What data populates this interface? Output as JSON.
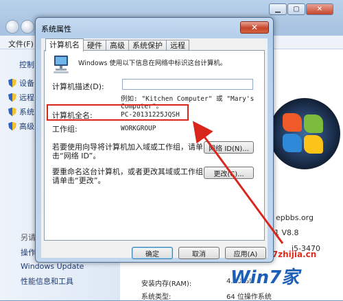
{
  "background": {
    "menu_file": "文件(F)",
    "left_panel": {
      "control": "控制",
      "items": [
        "设备",
        "远程",
        "系统",
        "高级"
      ],
      "see_also": "另请",
      "footer_items": [
        "操作",
        "Windows Update",
        "性能信息和工具"
      ]
    },
    "right_panel": {
      "site": "epbbs.org",
      "version": "1 V8.8",
      "cpu": "i5-3470",
      "ram_label": "安装内存(RAM):",
      "ram_value": "4.00 GB",
      "sys_type_label": "系统类型:",
      "sys_type_value": "64 位操作系统"
    },
    "watermark": {
      "url": "www.win7zhijia.cn",
      "logo": "Win7家"
    }
  },
  "dialog": {
    "title": "系统属性",
    "close_glyph": "✕",
    "tabs": [
      {
        "label": "计算机名",
        "active": true
      },
      {
        "label": "硬件"
      },
      {
        "label": "高级"
      },
      {
        "label": "系统保护"
      },
      {
        "label": "远程"
      }
    ],
    "intro": "Windows 使用以下信息在网络中标识这台计算机。",
    "description_label": "计算机描述(D):",
    "description_value": "",
    "example_line1": "例如: \"Kitchen Computer\" 或 \"Mary's",
    "example_line2": "Computer\"。",
    "full_name_label": "计算机全名:",
    "full_name_value": "PC-20131225JQSH",
    "workgroup_label": "工作组:",
    "workgroup_value": "WORKGROUP",
    "wizard_text_1": "若要使用向导将计算机加入域或工作组，请单",
    "wizard_text_2": "击“网络 ID”。",
    "network_id_button": "网络 ID(N)...",
    "rename_text_1": "要重命名这台计算机，或者更改其域或工作组，",
    "rename_text_2": "请单击“更改”。",
    "change_button": "更改(C)...",
    "ok_button": "确定",
    "cancel_button": "取消",
    "apply_button": "应用(A)"
  },
  "colors": {
    "annotation_red": "#d9261c",
    "dialog_frame": "#c2d7ee",
    "close_red": "#c7452c"
  }
}
